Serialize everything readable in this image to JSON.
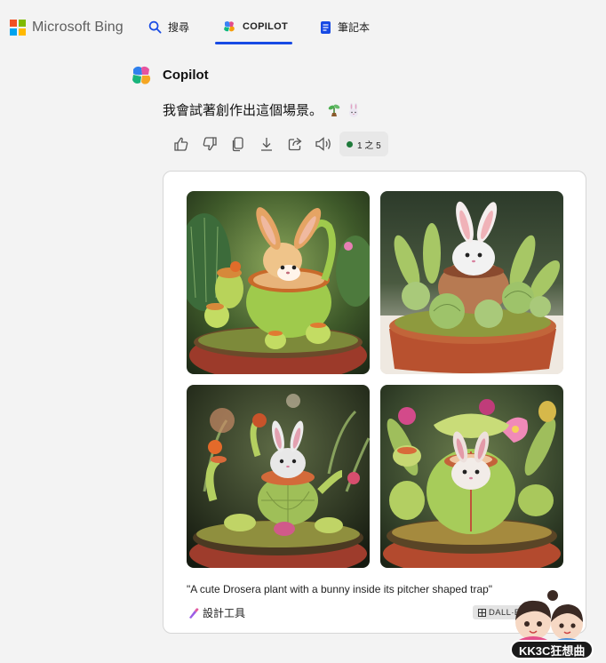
{
  "header": {
    "brand": "Microsoft Bing",
    "tabs": [
      {
        "label": "搜尋",
        "icon": "search-icon"
      },
      {
        "label": "COPILOT",
        "icon": "copilot-icon",
        "active": true
      },
      {
        "label": "筆記本",
        "icon": "notebook-icon"
      }
    ],
    "accent": "#174ae4"
  },
  "message": {
    "sender": "Copilot",
    "text": "我會試著創作出這個場景。",
    "emojis": [
      "seedling-icon",
      "rabbit-icon"
    ]
  },
  "actions": {
    "icons": [
      "thumbs-up-icon",
      "thumbs-down-icon",
      "copy-icon",
      "download-icon",
      "share-icon",
      "speaker-icon"
    ],
    "pager": "1 之 5",
    "status_color": "#1e7a3a"
  },
  "card": {
    "images": [
      "bunny-pitcher-plant-image-1",
      "bunny-pitcher-plant-image-2",
      "bunny-pitcher-plant-image-3",
      "bunny-pitcher-plant-image-4"
    ],
    "caption": "\"A cute Drosera plant with a bunny inside its pitcher shaped trap\"",
    "design_label": "設計工具",
    "dalle_label": "DALL·E"
  },
  "watermark": {
    "text": "KK3C狂想曲"
  }
}
